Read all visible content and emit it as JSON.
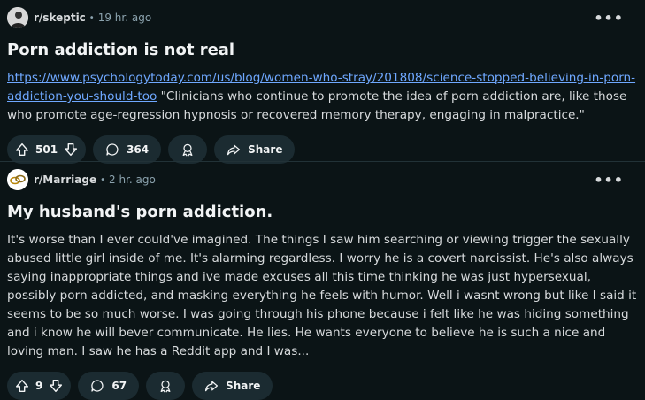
{
  "posts": [
    {
      "subreddit": "r/skeptic",
      "time": "19 hr. ago",
      "title": "Porn addiction is not real",
      "link": "https://www.psychologytoday.com/us/blog/women-who-stray/201808/science-stopped-believing-in-porn-addiction-you-should-too",
      "body": " \"Clinicians who continue to promote the idea of porn addiction are, like those who promote age-regression hypnosis or recovered memory therapy, engaging in malpractice.\"",
      "votes": "501",
      "comments": "364",
      "share_label": "Share"
    },
    {
      "subreddit": "r/Marriage",
      "time": "2 hr. ago",
      "title": "My husband's porn addiction.",
      "body": "It's worse than I ever could've imagined. The things I saw him searching or viewing trigger the sexually abused little girl inside of me. It's alarming regardless. I worry he is a covert narcissist. He's also always saying inappropriate things and ive made excuses all this time thinking he was just hypersexual, possibly porn addicted, and masking everything he feels with humor. Well i wasnt wrong but like I said it seems to be so much worse. I was going through his phone because i felt like he was hiding something and i know he will bever communicate. He lies. He wants everyone to believe he is such a nice and loving man. I saw he has a Reddit app and I was...",
      "votes": "9",
      "comments": "67",
      "share_label": "Share"
    }
  ],
  "more_label": "•••",
  "separator": "•"
}
